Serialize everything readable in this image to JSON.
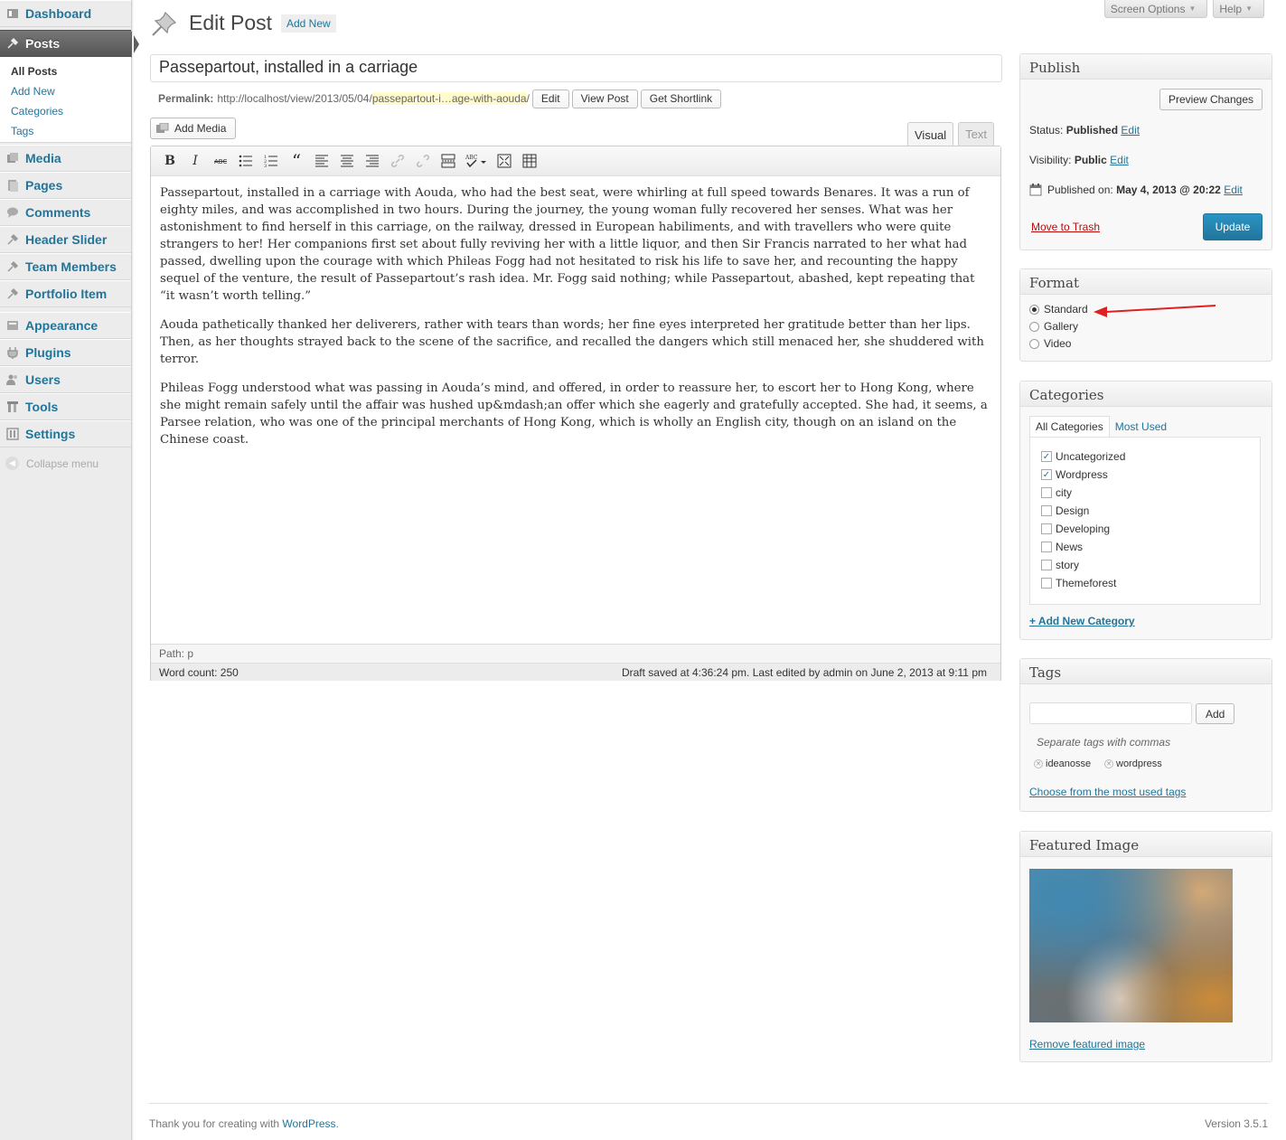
{
  "menu": {
    "items": [
      {
        "label": "Dashboard",
        "icon": "dashboard-icon"
      },
      {
        "label": "Posts",
        "icon": "pin-icon"
      },
      {
        "label": "Media",
        "icon": "media-icon"
      },
      {
        "label": "Pages",
        "icon": "pages-icon"
      },
      {
        "label": "Comments",
        "icon": "comments-icon"
      },
      {
        "label": "Header Slider",
        "icon": "pin-icon"
      },
      {
        "label": "Team Members",
        "icon": "pin-icon"
      },
      {
        "label": "Portfolio Item",
        "icon": "pin-icon"
      },
      {
        "label": "Appearance",
        "icon": "appearance-icon"
      },
      {
        "label": "Plugins",
        "icon": "plugins-icon"
      },
      {
        "label": "Users",
        "icon": "users-icon"
      },
      {
        "label": "Tools",
        "icon": "tools-icon"
      },
      {
        "label": "Settings",
        "icon": "settings-icon"
      }
    ],
    "submenu": [
      "All Posts",
      "Add New",
      "Categories",
      "Tags"
    ],
    "collapse": "Collapse menu"
  },
  "header": {
    "screen_options": "Screen Options",
    "help": "Help",
    "title": "Edit Post",
    "add_new": "Add New"
  },
  "post": {
    "title": "Passepartout, installed in a carriage",
    "permalink_label": "Permalink:",
    "permalink_base": "http://localhost/view/2013/05/04/",
    "permalink_slug": "passepartout-i…age-with-aouda",
    "permalink_tail": "/",
    "edit_btn": "Edit",
    "view_btn": "View Post",
    "shortlink_btn": "Get Shortlink"
  },
  "editor": {
    "add_media": "Add Media",
    "tab_visual": "Visual",
    "tab_text": "Text",
    "path": "Path: p",
    "word_count": "Word count: 250",
    "draft_status": "Draft saved at 4:36:24 pm. Last edited by admin on June 2, 2013 at 9:11 pm",
    "paragraphs": [
      "Passepartout, installed in a carriage with Aouda, who had the best seat, were whirling at full speed towards Benares. It was a run of eighty miles, and was accomplished in two hours. During the journey, the young woman fully recovered her senses. What was her astonishment to find herself in this carriage, on the railway, dressed in European habiliments, and with travellers who were quite strangers to her! Her companions first set about fully reviving her with a little liquor, and then Sir Francis narrated to her what had passed, dwelling upon the courage with which Phileas Fogg had not hesitated to risk his life to save her, and recounting the happy sequel of the venture, the result of Passepartout’s rash idea. Mr. Fogg said nothing; while Passepartout, abashed, kept repeating that “it wasn’t worth telling.”",
      "Aouda pathetically thanked her deliverers, rather with tears than words; her fine eyes interpreted her gratitude better than her lips. Then, as her thoughts strayed back to the scene of the sacrifice, and recalled the dangers which still menaced her, she shuddered with terror.",
      "Phileas Fogg understood what was passing in Aouda’s mind, and offered, in order to reassure her, to escort her to Hong Kong, where she might remain safely until the affair was hushed up&mdash;an offer which she eagerly and gratefully accepted. She had, it seems, a Parsee relation, who was one of the principal merchants of Hong Kong, which is wholly an English city, though on an island on the Chinese coast."
    ]
  },
  "publish": {
    "heading": "Publish",
    "preview": "Preview Changes",
    "status_label": "Status:",
    "status_value": "Published",
    "visibility_label": "Visibility:",
    "visibility_value": "Public",
    "published_label": "Published on:",
    "published_value": "May 4, 2013 @ 20:22",
    "edit": "Edit",
    "trash": "Move to Trash",
    "update": "Update"
  },
  "format": {
    "heading": "Format",
    "options": [
      "Standard",
      "Gallery",
      "Video"
    ],
    "selected": "Standard"
  },
  "categories": {
    "heading": "Categories",
    "tab_all": "All Categories",
    "tab_most": "Most Used",
    "items": [
      {
        "name": "Uncategorized",
        "checked": true
      },
      {
        "name": "Wordpress",
        "checked": true
      },
      {
        "name": "city",
        "checked": false
      },
      {
        "name": "Design",
        "checked": false
      },
      {
        "name": "Developing",
        "checked": false
      },
      {
        "name": "News",
        "checked": false
      },
      {
        "name": "story",
        "checked": false
      },
      {
        "name": "Themeforest",
        "checked": false
      }
    ],
    "add_new": "+ Add New Category"
  },
  "tags": {
    "heading": "Tags",
    "add_btn": "Add",
    "hint": "Separate tags with commas",
    "items": [
      "ideanosse",
      "wordpress"
    ],
    "choose": "Choose from the most used tags"
  },
  "featured": {
    "heading": "Featured Image",
    "remove": "Remove featured image"
  },
  "footer": {
    "thanks": "Thank you for creating with ",
    "wp": "WordPress",
    "dot": ".",
    "version": "Version 3.5.1"
  },
  "colors": {
    "accent": "#21759b",
    "primary_button": "#2a95c5",
    "trash": "#bc0b0b",
    "annotation_arrow": "#e02020"
  }
}
